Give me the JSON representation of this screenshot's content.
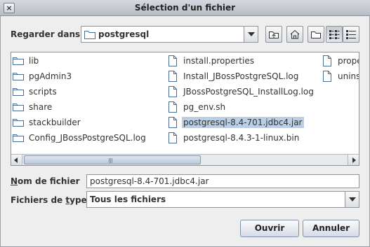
{
  "window": {
    "title": "Sélection d'un fichier",
    "close_glyph": "×"
  },
  "toolbar": {
    "lookin_label": "Regarder dans",
    "lookin_value": "postgresql",
    "buttons": [
      "up-folder-icon",
      "home-icon",
      "new-folder-icon",
      "list-view-icon",
      "details-view-icon"
    ]
  },
  "files": {
    "col1": [
      {
        "name": "lib",
        "type": "folder"
      },
      {
        "name": "pgAdmin3",
        "type": "folder"
      },
      {
        "name": "scripts",
        "type": "folder"
      },
      {
        "name": "share",
        "type": "folder"
      },
      {
        "name": "stackbuilder",
        "type": "folder"
      },
      {
        "name": "Config_JBossPostgreSQL.log",
        "type": "folder"
      }
    ],
    "col2": [
      {
        "name": "install.properties",
        "type": "file"
      },
      {
        "name": "Install_JBossPostgreSQL.log",
        "type": "file"
      },
      {
        "name": "JBossPostgreSQL_InstallLog.log",
        "type": "file"
      },
      {
        "name": "pg_env.sh",
        "type": "file"
      },
      {
        "name": "postgresql-8.4-701.jdbc4.jar",
        "type": "file",
        "selected": true
      },
      {
        "name": "postgresql-8.4.3-1-linux.bin",
        "type": "file"
      }
    ],
    "col3": [
      {
        "name": "prope",
        "type": "file"
      },
      {
        "name": "uninst",
        "type": "file"
      }
    ]
  },
  "filename": {
    "label_u": "N",
    "label_rest": "om de fichier",
    "value": "postgresql-8.4-701.jdbc4.jar"
  },
  "filetype": {
    "label_pre": "Fichiers de ",
    "label_u": "t",
    "label_post": "ype",
    "value": "Tous les fichiers"
  },
  "actions": {
    "open": "Ouvrir",
    "cancel": "Annuler"
  },
  "colors": {
    "selection": "#b8cfe5",
    "folder": "#4a6d95"
  }
}
